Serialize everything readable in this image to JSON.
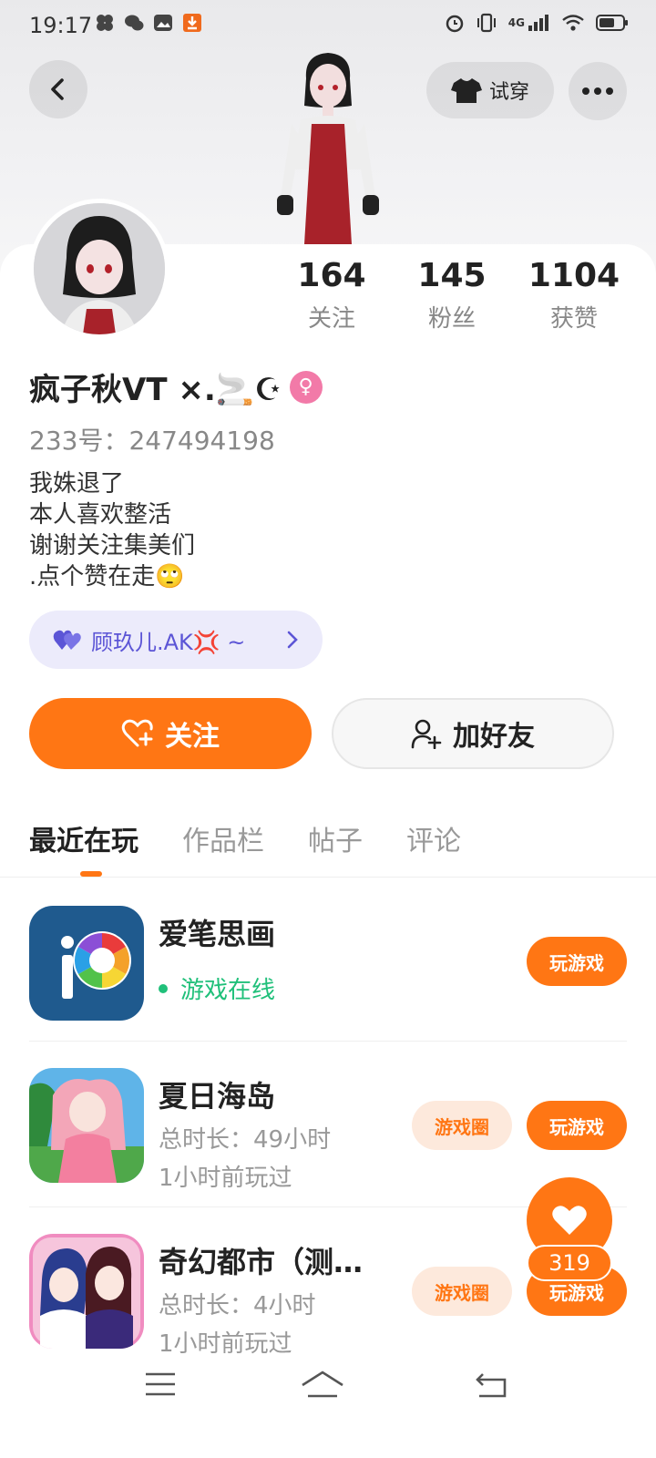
{
  "status_bar": {
    "time": "19:17",
    "network": "4G"
  },
  "header": {
    "try_on_label": "试穿",
    "icons": [
      "back-arrow-icon",
      "shirt-icon",
      "more-dots-icon"
    ]
  },
  "profile": {
    "name": "疯子秋VT ×.🚬☪",
    "gender_symbol": "♀",
    "uid_text": "233号：247494198",
    "bio_lines": [
      "我姝退了",
      "本人喜欢整活",
      "谢谢关注集美们",
      ".点个赞在走🙄"
    ],
    "relation_tag": "顾玖儿.AK💢 ~"
  },
  "stats": [
    {
      "value": "164",
      "label": "关注"
    },
    {
      "value": "145",
      "label": "粉丝"
    },
    {
      "value": "1104",
      "label": "获赞"
    }
  ],
  "actions": {
    "follow_label": "关注",
    "add_friend_label": "加好友"
  },
  "tabs": [
    "最近在玩",
    "作品栏",
    "帖子",
    "评论"
  ],
  "active_tab": "最近在玩",
  "games": [
    {
      "title": "爱笔思画",
      "status": "游戏在线",
      "play_label": "玩游戏"
    },
    {
      "title": "夏日海岛",
      "duration": "总时长：49小时",
      "last_played": "1小时前玩过",
      "circle_label": "游戏圈",
      "play_label": "玩游戏"
    },
    {
      "title": "奇幻都市（测…",
      "duration": "总时长：4小时",
      "last_played": "1小时前玩过",
      "circle_label": "游戏圈",
      "play_label": "玩游戏"
    }
  ],
  "like_fab": {
    "count": "319"
  },
  "colors": {
    "accent": "#ff7614",
    "online_green": "#20c07a",
    "relation_purple": "#5c55d6"
  }
}
